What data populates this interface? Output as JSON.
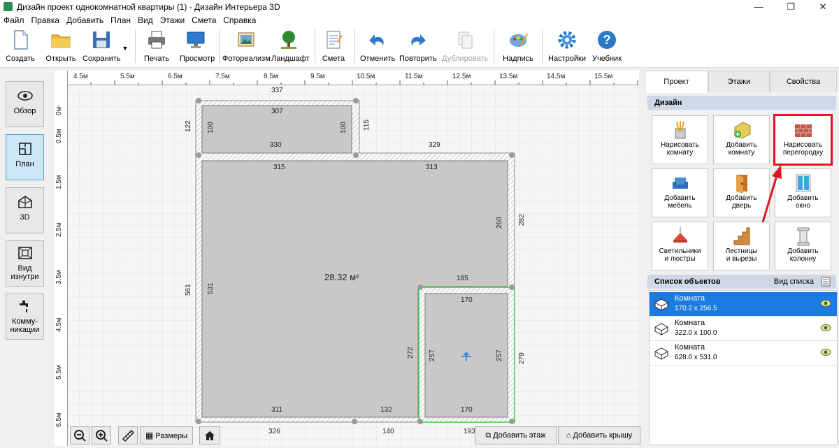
{
  "window": {
    "title": "Дизайн проект однокомнатной квартиры (1) - Дизайн Интерьера 3D",
    "minimize": "—",
    "restore": "❐",
    "close": "✕"
  },
  "menu": [
    "Файл",
    "Правка",
    "Добавить",
    "План",
    "Вид",
    "Этажи",
    "Смета",
    "Справка"
  ],
  "toolbar": {
    "create": "Создать",
    "open": "Открыть",
    "save": "Сохранить",
    "print": "Печать",
    "preview": "Просмотр",
    "photoreal": "Фотореализм",
    "landscape": "Ландшафт",
    "estimate": "Смета",
    "undo": "Отменить",
    "redo": "Повторить",
    "duplicate": "Дублировать",
    "caption": "Надпись",
    "settings": "Настройки",
    "tutorial": "Учебник"
  },
  "leftbar": {
    "overview": "Обзор",
    "plan": "План",
    "view3d": "3D",
    "inside1": "Вид",
    "inside2": "изнутри",
    "comm1": "Комму-",
    "comm2": "никации"
  },
  "ruler": {
    "top": [
      "4.5м",
      "5.5м",
      "6.5м",
      "7.5м",
      "8.5м",
      "9.5м",
      "10.5м",
      "11.5м",
      "12.5м",
      "13.5м",
      "14.5м",
      "15.5м"
    ],
    "left": [
      "0м",
      "-",
      "0.5м",
      "1.5м",
      "2.5м",
      "3.5м",
      "4.5м",
      "5.5м",
      "6.5м"
    ]
  },
  "plan": {
    "area": "28.32 м²",
    "dims": {
      "d337": "337",
      "d307": "307",
      "d122": "122",
      "d100a": "100",
      "d100b": "100",
      "d115": "115",
      "d330": "330",
      "d329": "329",
      "d315": "315",
      "d313": "313",
      "d260": "260",
      "d282": "282",
      "d561": "561",
      "d531": "531",
      "d185": "185",
      "d170a": "170",
      "d272": "272",
      "d257a": "257",
      "d257b": "257",
      "d279": "279",
      "d311": "311",
      "d132": "132",
      "d170b": "170",
      "d326": "326",
      "d140": "140",
      "d193": "193"
    }
  },
  "bottom": {
    "sizes": "Размеры",
    "add_floor": "Добавить этаж",
    "add_roof": "Добавить крышу"
  },
  "right": {
    "tabs": [
      "Проект",
      "Этажи",
      "Свойства"
    ],
    "design_header": "Дизайн",
    "buttons": [
      {
        "l1": "Нарисовать",
        "l2": "комнату"
      },
      {
        "l1": "Добавить",
        "l2": "комнату"
      },
      {
        "l1": "Нарисовать",
        "l2": "перегородку"
      },
      {
        "l1": "Добавить",
        "l2": "мебель"
      },
      {
        "l1": "Добавить",
        "l2": "дверь"
      },
      {
        "l1": "Добавить",
        "l2": "окно"
      },
      {
        "l1": "Светильники",
        "l2": "и люстры"
      },
      {
        "l1": "Лестницы",
        "l2": "и вырезы"
      },
      {
        "l1": "Добавить",
        "l2": "колонну"
      }
    ],
    "objects_header": "Список объектов",
    "list_view": "Вид списка",
    "objects": [
      {
        "name": "Комната",
        "size": "170.2 x 256.5"
      },
      {
        "name": "Комната",
        "size": "322.0 x 100.0"
      },
      {
        "name": "Комната",
        "size": "628.0 x 531.0"
      }
    ]
  },
  "colors": {
    "accent": "#1c7be1",
    "highlight": "#e0141e",
    "selection": "#3ad13a",
    "room": "#c8c8c8"
  }
}
